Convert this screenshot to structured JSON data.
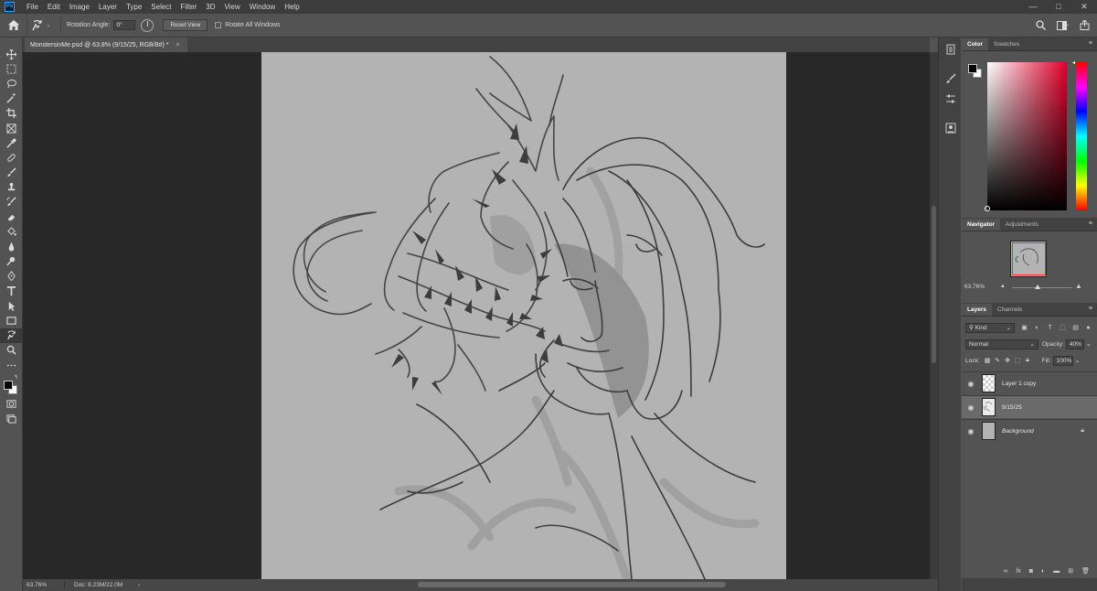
{
  "menubar": {
    "logo": "Ps",
    "items": [
      "File",
      "Edit",
      "Image",
      "Layer",
      "Type",
      "Select",
      "Filter",
      "3D",
      "View",
      "Window",
      "Help"
    ],
    "window_controls": [
      "—",
      "□",
      "✕"
    ]
  },
  "options": {
    "rotation_label": "Rotation Angle:",
    "rotation_value": "0°",
    "reset_view": "Reset View",
    "rotate_all": "Rotate All Windows"
  },
  "document": {
    "tab_title": "MonstersinMe.psd @ 63.8% (9/15/25, RGB/8#) *",
    "close": "×"
  },
  "status": {
    "zoom": "63.76%",
    "doc_info": "Doc: 8.23M/22.0M",
    "arrow": "›"
  },
  "panels": {
    "color": {
      "tabs": [
        "Color",
        "Swatches"
      ],
      "foreground": "#000000",
      "background": "#ffffff",
      "hue": "#e0002a"
    },
    "navigator": {
      "tabs": [
        "Navigator",
        "Adjustments"
      ],
      "zoom": "63.76%"
    },
    "layers": {
      "tabs": [
        "Layers",
        "Channels"
      ],
      "filter": "Kind",
      "blend_mode": "Normal",
      "opacity_label": "Opacity:",
      "opacity_value": "40%",
      "lock_label": "Lock:",
      "fill_label": "Fill:",
      "fill_value": "100%",
      "items": [
        {
          "name": "Layer 1 copy",
          "visible": true,
          "selected": false
        },
        {
          "name": "9/15/25",
          "visible": true,
          "selected": true
        },
        {
          "name": "Background",
          "visible": true,
          "selected": false,
          "locked": true
        }
      ]
    }
  },
  "icons": {
    "tools": [
      "move-icon",
      "marquee-icon",
      "lasso-icon",
      "magic-wand-icon",
      "crop-icon",
      "frame-icon",
      "eyedropper-icon",
      "healing-brush-icon",
      "brush-icon",
      "clone-stamp-icon",
      "history-brush-icon",
      "eraser-icon",
      "paint-bucket-icon",
      "blur-icon",
      "dodge-icon",
      "pen-icon",
      "type-icon",
      "path-selection-icon",
      "rectangle-icon",
      "rotate-view-icon",
      "zoom-icon",
      "more-tools-icon"
    ]
  }
}
